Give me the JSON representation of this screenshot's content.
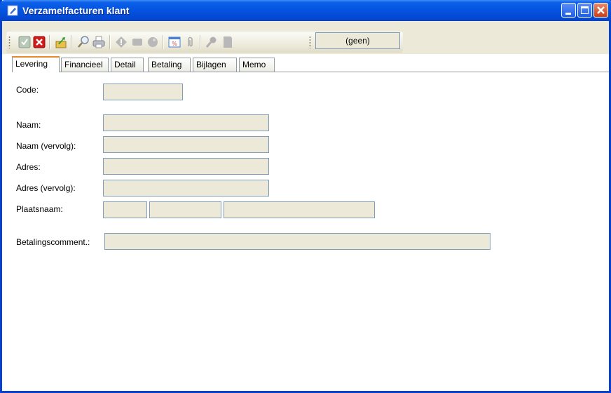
{
  "window": {
    "title": "Verzamelfacturen klant"
  },
  "toolbar": {
    "icons": [
      "check-icon",
      "delete-icon",
      "export-icon",
      "search-icon",
      "print-icon",
      "info-icon",
      "stop-icon",
      "record-icon",
      "discount-icon",
      "attach-icon",
      "key-icon",
      "note-icon"
    ],
    "filter_value": "(geen)"
  },
  "tabs": [
    {
      "label": "Levering",
      "active": true
    },
    {
      "label": "Financieel",
      "active": false
    },
    {
      "label": "Detail",
      "active": false
    },
    {
      "label": "Betaling",
      "active": false
    },
    {
      "label": "Bijlagen",
      "active": false
    },
    {
      "label": "Memo",
      "active": false
    }
  ],
  "form": {
    "code_label": "Code:",
    "naam_label": "Naam:",
    "naam_vervolg_label": "Naam (vervolg):",
    "adres_label": "Adres:",
    "adres_vervolg_label": "Adres (vervolg):",
    "plaatsnaam_label": "Plaatsnaam:",
    "betalingscomment_label": "Betalingscomment.:",
    "code_value": "",
    "naam_value": "",
    "naam_vervolg_value": "",
    "adres_value": "",
    "adres_vervolg_value": "",
    "postcode_value": "",
    "plaats_value": "",
    "land_value": "",
    "betalingscomment_value": ""
  },
  "colors": {
    "titlebar": "#0555e0",
    "field_bg": "#ece9d8",
    "field_border": "#7f9db9",
    "active_tab_accent": "#e68b2c"
  }
}
